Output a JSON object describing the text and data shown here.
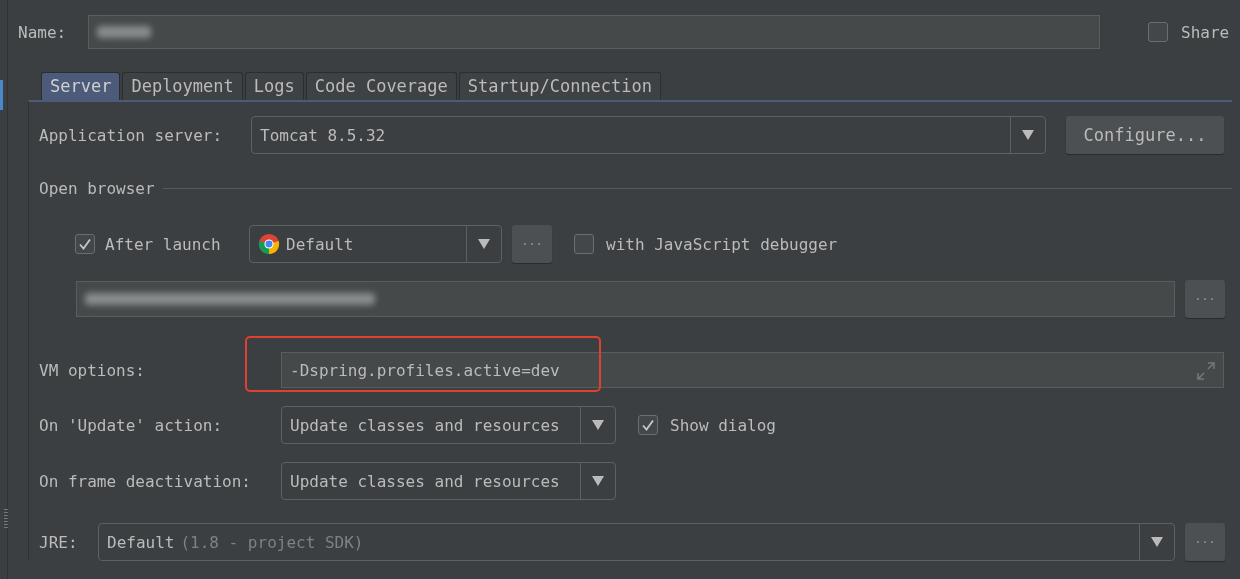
{
  "name_field": {
    "label": "Name:",
    "redacted": true
  },
  "share": {
    "label": "Share",
    "checked": false
  },
  "tabs": [
    {
      "label": "Server",
      "selected": true
    },
    {
      "label": "Deployment",
      "selected": false
    },
    {
      "label": "Logs",
      "selected": false
    },
    {
      "label": "Code Coverage",
      "selected": false
    },
    {
      "label": "Startup/Connection",
      "selected": false
    }
  ],
  "application_server": {
    "label": "Application server:",
    "value": "Tomcat 8.5.32",
    "button": "Configure..."
  },
  "open_browser": {
    "title": "Open browser",
    "after_launch": {
      "label": "After launch",
      "checked": true
    },
    "browser": {
      "value": "Default",
      "more_button": "···"
    },
    "js_debugger": {
      "label": "with JavaScript debugger",
      "checked": false
    },
    "url": {
      "redacted": true,
      "more_button": "···"
    }
  },
  "vm_options": {
    "label": "VM options:",
    "value": "-Dspring.profiles.active=dev",
    "highlighted": true
  },
  "update_action": {
    "label": "On 'Update' action:",
    "value": "Update classes and resources",
    "show_dialog": {
      "label": "Show dialog",
      "checked": true
    }
  },
  "frame_deactivation": {
    "label": "On frame deactivation:",
    "value": "Update classes and resources"
  },
  "jre": {
    "label": "JRE:",
    "value": "Default",
    "hint": "(1.8 - project SDK)",
    "more_button": "···"
  }
}
